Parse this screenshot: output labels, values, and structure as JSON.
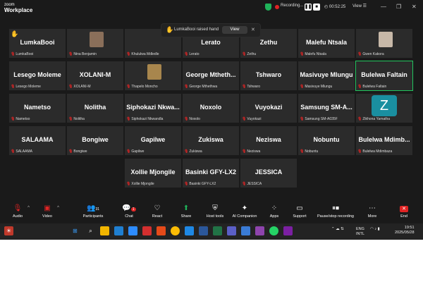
{
  "app": {
    "logo_line1": "zoom",
    "logo_line2": "Workplace"
  },
  "header": {
    "recording_text": "Recording...",
    "timer": "00:52:25",
    "view_label": "View",
    "view_caret": "☰"
  },
  "notification": {
    "text": "LumkaBooi raised hand",
    "button": "View",
    "close": "✕"
  },
  "tiles": [
    {
      "name": "LumkaBooi",
      "label": "LumkaBooi",
      "hand": true
    },
    {
      "name": "",
      "label": "Nina Benjamin",
      "avatar": "photo-1"
    },
    {
      "name": "",
      "label": "Khululwa Mdledle"
    },
    {
      "name": "Lerato",
      "label": "Lerato"
    },
    {
      "name": "Zethu",
      "label": "Zethu"
    },
    {
      "name": "Malefu Ntsala",
      "label": "Malefu Ntsala"
    },
    {
      "name": "",
      "label": "Gwen Kakora",
      "avatar": "photo-2"
    },
    {
      "name": "Lesego Moleme",
      "label": "Lesego Moleme"
    },
    {
      "name": "XOLANI-M",
      "label": "XOLANI-M"
    },
    {
      "name": "",
      "label": "Thapelo Moncho",
      "avatar": "photo-3"
    },
    {
      "name": "George Mtheth...",
      "label": "George Mthethwa"
    },
    {
      "name": "Tshwaro",
      "label": "Tshwaro"
    },
    {
      "name": "Masivuye Mlungu",
      "label": "Masivuye Mlungu"
    },
    {
      "name": "Bulelwa Faltain",
      "label": "Bulelwa Faltain",
      "active": true
    },
    {
      "name": "Nametso",
      "label": "Nametso"
    },
    {
      "name": "Nolitha",
      "label": "Nolitha"
    },
    {
      "name": "Siphokazi Nkwa...",
      "label": "Siphokazi Nkwandla"
    },
    {
      "name": "Noxolo",
      "label": "Noxolo"
    },
    {
      "name": "Vuyokazi",
      "label": "Vuyokazi"
    },
    {
      "name": "Samsung SM-A...",
      "label": "Samsung SM-A035F"
    },
    {
      "name": "",
      "label": "Zikhona Yamatha",
      "initial": "Z"
    },
    {
      "name": "SALAAMA",
      "label": "SALAAMA"
    },
    {
      "name": "Bongiwe",
      "label": "Bongiwe"
    },
    {
      "name": "Gapilwe",
      "label": "Gapilwe"
    },
    {
      "name": "Zukiswa",
      "label": "Zukiswa"
    },
    {
      "name": "Neziswa",
      "label": "Neziswa"
    },
    {
      "name": "Nobuntu",
      "label": "Nobuntu"
    },
    {
      "name": "Bulelwa Mdimb...",
      "label": "Bulelwa Mdimbaza"
    },
    {
      "name": "Xollie Mjongile",
      "label": "Xollie Mjongile"
    },
    {
      "name": "Basinki GFY-LX2",
      "label": "Basinki GFY-LX2"
    },
    {
      "name": "JESSICA",
      "label": "JESSICA"
    }
  ],
  "toolbar": {
    "audio": "Audio",
    "video": "Video",
    "participants": "Participants",
    "participants_count": "31",
    "chat": "Chat",
    "chat_badge": "1",
    "react": "React",
    "share": "Share",
    "host_tools": "Host tools",
    "ai_companion": "AI Companion",
    "apps": "Apps",
    "support": "Support",
    "pause_recording": "Pause/stop recording",
    "more": "More",
    "end": "End"
  },
  "taskbar": {
    "lang1": "ENG",
    "lang2": "INTL",
    "time": "19:51",
    "date": "2025/05/28"
  },
  "colors": {
    "accent_green": "#1fb35a",
    "danger_red": "#e02424",
    "active_border": "#22c55e",
    "hand_yellow": "#f5c400"
  }
}
